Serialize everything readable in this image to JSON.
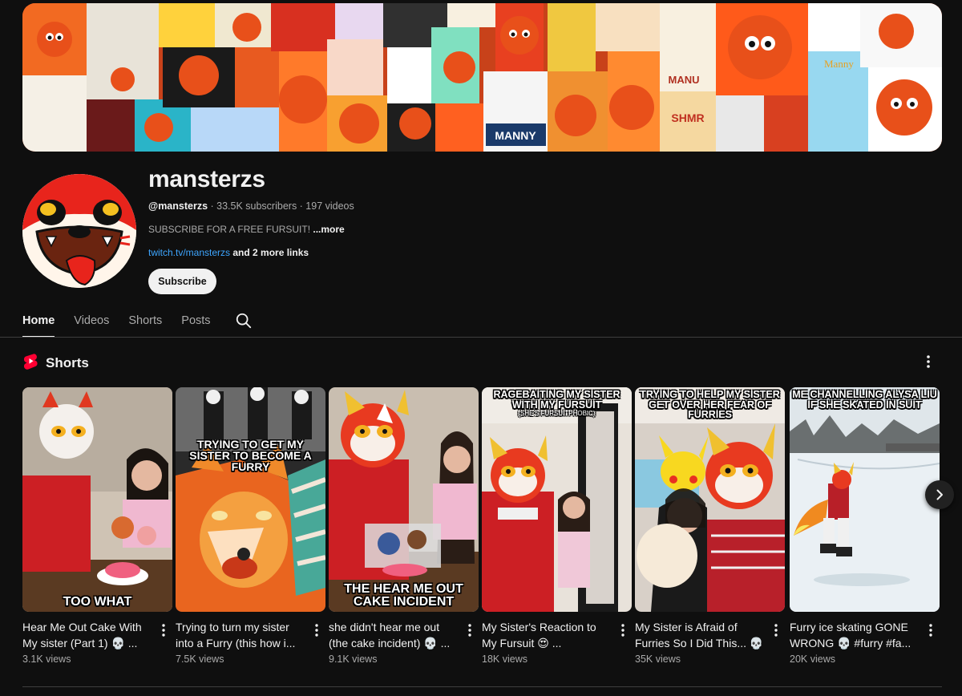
{
  "channel": {
    "name": "mansterzs",
    "handle": "@mansterzs",
    "stats": " · 33.5K subscribers · 197 videos",
    "description": "SUBSCRIBE FOR A FREE FURSUIT!",
    "more_label": " ...more",
    "link": "twitch.tv/mansterzs",
    "more_links": " and 2 more links",
    "subscribe_label": "Subscribe"
  },
  "tabs": [
    {
      "label": "Home",
      "active": true
    },
    {
      "label": "Videos",
      "active": false
    },
    {
      "label": "Shorts",
      "active": false
    },
    {
      "label": "Posts",
      "active": false
    }
  ],
  "shorts_section": {
    "title": "Shorts",
    "items": [
      {
        "title": "Hear Me Out Cake With My sister (Part 1) 💀 ...",
        "views": "3.1K views",
        "caption_top": "",
        "caption_bottom": "TOO WHAT"
      },
      {
        "title": "Trying to turn my sister into a Furry (this how i...",
        "views": "7.5K views",
        "caption_top": "TRYING TO GET MY SISTER TO BECOME A FURRY",
        "caption_bottom": ""
      },
      {
        "title": "she didn't hear me out (the cake incident) 💀 ...",
        "views": "9.1K views",
        "caption_top": "",
        "caption_bottom": "THE HEAR ME OUT CAKE INCIDENT"
      },
      {
        "title": "My Sister's Reaction to My Fursuit 😍 ...",
        "views": "18K views",
        "caption_top": "RAGEBAITING MY SISTER WITH MY FURSUIT",
        "caption_sub": "(she's fursuitphobic)",
        "caption_bottom": ""
      },
      {
        "title": "My Sister is Afraid of Furries So I Did This... 💀 ...",
        "views": "35K views",
        "caption_top": "TRYING TO HELP MY SISTER GET OVER HER FEAR OF FURRIES",
        "caption_bottom": ""
      },
      {
        "title": "Furry ice skating GONE WRONG 💀 #furry #fa...",
        "views": "20K views",
        "caption_top": "ME CHANNELLING ALYSA LIU IF SHE SKATED IN SUIT",
        "caption_bottom": ""
      }
    ]
  },
  "banner_art": {
    "text_fragments": [
      "MANNY",
      "MANU",
      "Manny",
      "SHMR"
    ]
  },
  "colors": {
    "background": "#0f0f0f",
    "accent_red": "#ff0033",
    "link_blue": "#3ea6ff",
    "secondary_text": "#aaaaaa"
  },
  "icons": {
    "search": "search-icon",
    "shorts": "shorts-logo-icon",
    "menu": "more-vert-icon",
    "next": "chevron-right-icon"
  }
}
